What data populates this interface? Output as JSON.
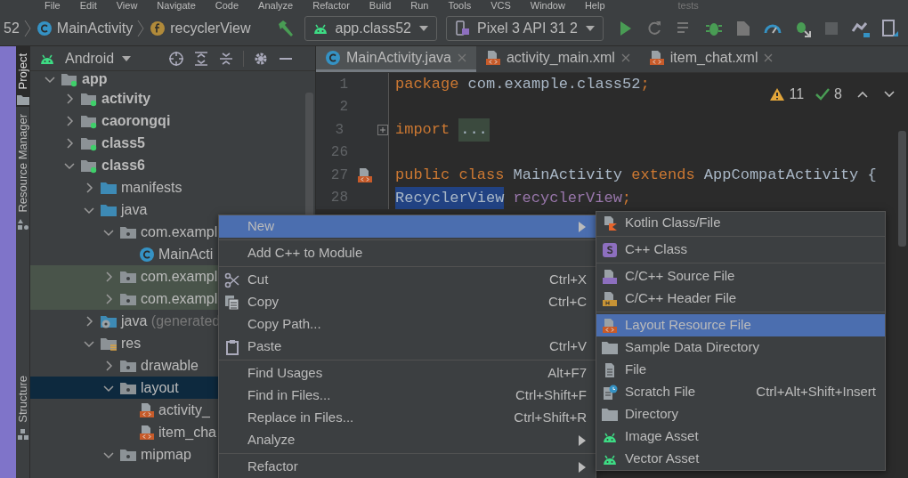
{
  "menu_bar": {
    "items": [
      "File",
      "Edit",
      "View",
      "Navigate",
      "Code",
      "Analyze",
      "Refactor",
      "Build",
      "Run",
      "Tools",
      "VCS",
      "Window",
      "Help"
    ],
    "title": "tests"
  },
  "toolbar": {
    "breadcrumbs": [
      {
        "kind": "plain",
        "label": "52"
      },
      {
        "kind": "class",
        "label": "MainActivity"
      },
      {
        "kind": "field",
        "label": "recyclerView"
      }
    ],
    "run_config": "app.class52",
    "device": "Pixel 3 API 31 2"
  },
  "tool_stripe": [
    {
      "label": "Project",
      "selected": true,
      "kind": "folder"
    },
    {
      "label": "Resource Manager",
      "selected": false,
      "kind": "shapes"
    },
    {
      "label": "Structure",
      "selected": false,
      "kind": "structure"
    }
  ],
  "project_panel": {
    "view": "Android",
    "tree": [
      {
        "label": "app",
        "kind": "module",
        "selected": false,
        "expanded": true,
        "children": [
          {
            "label": "activity",
            "kind": "module",
            "selected": false,
            "expanded": false
          },
          {
            "label": "caorongqi",
            "kind": "module",
            "selected": false,
            "expanded": false
          },
          {
            "label": "class5",
            "kind": "module",
            "selected": false,
            "expanded": false
          },
          {
            "label": "class6",
            "kind": "module",
            "selected": false,
            "expanded": true,
            "children": [
              {
                "label": "manifests",
                "kind": "folder",
                "selected": false,
                "expanded": false
              },
              {
                "label": "java",
                "kind": "folder",
                "selected": false,
                "expanded": true,
                "children": [
                  {
                    "label": "com.exampl",
                    "kind": "package",
                    "selected": false,
                    "expanded": true,
                    "children": [
                      {
                        "label": "MainActi",
                        "kind": "class",
                        "selected": false
                      }
                    ]
                  },
                  {
                    "label": "com.exampl",
                    "kind": "testpackage",
                    "selected": false,
                    "expanded": false
                  },
                  {
                    "label": "com.exampl",
                    "kind": "testpackage",
                    "selected": false,
                    "expanded": false
                  }
                ]
              },
              {
                "label": "java (generated",
                "kind": "generated",
                "selected": false,
                "expanded": false
              },
              {
                "label": "res",
                "kind": "res",
                "selected": false,
                "expanded": true,
                "children": [
                  {
                    "label": "drawable",
                    "kind": "package",
                    "selected": false,
                    "expanded": false
                  },
                  {
                    "label": "layout",
                    "kind": "package",
                    "selected": true,
                    "expanded": true,
                    "children": [
                      {
                        "label": "activity_",
                        "kind": "layout",
                        "selected": false
                      },
                      {
                        "label": "item_cha",
                        "kind": "layout",
                        "selected": false
                      }
                    ]
                  },
                  {
                    "label": "mipmap",
                    "kind": "package",
                    "selected": false,
                    "expanded": true
                  }
                ]
              }
            ]
          }
        ]
      }
    ]
  },
  "editor": {
    "tabs": [
      {
        "label": "MainActivity.java",
        "kind": "java",
        "selected": true
      },
      {
        "label": "activity_main.xml",
        "kind": "xml",
        "selected": false
      },
      {
        "label": "item_chat.xml",
        "kind": "xml",
        "selected": false
      }
    ],
    "warnings": "11",
    "passed": "8",
    "lines": [
      {
        "number": "1",
        "kind": "plain",
        "tokens": [
          {
            "kind": "keyword",
            "text": "package"
          },
          {
            "kind": "plain",
            "text": " com.example.class52"
          },
          {
            "kind": "keyword",
            "text": ";"
          }
        ]
      },
      {
        "number": "2",
        "kind": "plain"
      },
      {
        "number": "3",
        "kind": "fold",
        "tokens": [
          {
            "kind": "keyword",
            "text": "import"
          },
          {
            "kind": "folded",
            "text": "..."
          }
        ]
      },
      {
        "number": "26",
        "kind": "plain"
      },
      {
        "number": "27",
        "kind": "layout",
        "tokens": [
          {
            "kind": "keyword",
            "text": "public class"
          },
          {
            "kind": "plain",
            "text": " MainActivity "
          },
          {
            "kind": "keyword",
            "text": "extends"
          },
          {
            "kind": "plain",
            "text": " AppCompatActivity {"
          }
        ]
      },
      {
        "number": "28",
        "kind": "plain",
        "tokens": [
          {
            "kind": "selected",
            "text": "RecyclerView"
          },
          {
            "kind": "field",
            "text": "recyclerView"
          },
          {
            "kind": "keyword",
            "text": ";"
          }
        ]
      }
    ]
  },
  "context_menu": {
    "items": [
      {
        "kind": "item",
        "label": "New",
        "selected": true,
        "submenu": true
      },
      {
        "kind": "separator"
      },
      {
        "kind": "item",
        "label": "Add C++ to Module",
        "selected": false,
        "submenu": false
      },
      {
        "kind": "separator"
      },
      {
        "kind": "cut",
        "label": "Cut",
        "shortcut": "Ctrl+X",
        "selected": false,
        "submenu": false
      },
      {
        "kind": "copy",
        "label": "Copy",
        "shortcut": "Ctrl+C",
        "selected": false,
        "submenu": false
      },
      {
        "kind": "item",
        "label": "Copy Path...",
        "selected": false,
        "submenu": false
      },
      {
        "kind": "paste",
        "label": "Paste",
        "shortcut": "Ctrl+V",
        "selected": false,
        "submenu": false
      },
      {
        "kind": "separator"
      },
      {
        "kind": "item",
        "label": "Find Usages",
        "shortcut": "Alt+F7",
        "selected": false,
        "submenu": false
      },
      {
        "kind": "item",
        "label": "Find in Files...",
        "shortcut": "Ctrl+Shift+F",
        "selected": false,
        "submenu": false
      },
      {
        "kind": "item",
        "label": "Replace in Files...",
        "shortcut": "Ctrl+Shift+R",
        "selected": false,
        "submenu": false
      },
      {
        "kind": "item",
        "label": "Analyze",
        "selected": false,
        "submenu": true
      },
      {
        "kind": "separator"
      },
      {
        "kind": "item",
        "label": "Refactor",
        "selected": false,
        "submenu": true
      }
    ]
  },
  "submenu": {
    "items": [
      {
        "kind": "kotlin",
        "label": "Kotlin Class/File",
        "selected": false
      },
      {
        "kind": "separator"
      },
      {
        "kind": "cppclass",
        "label": "C++ Class",
        "selected": false
      },
      {
        "kind": "separator"
      },
      {
        "kind": "source",
        "label": "C/C++ Source File",
        "selected": false
      },
      {
        "kind": "header",
        "label": "C/C++ Header File",
        "selected": false
      },
      {
        "kind": "separator"
      },
      {
        "kind": "layout",
        "label": "Layout Resource File",
        "selected": true
      },
      {
        "kind": "folder",
        "label": "Sample Data Directory",
        "selected": false
      },
      {
        "kind": "file",
        "label": "File",
        "selected": false
      },
      {
        "kind": "scratch",
        "label": "Scratch File",
        "shortcut": "Ctrl+Alt+Shift+Insert",
        "selected": false
      },
      {
        "kind": "folder",
        "label": "Directory",
        "selected": false
      },
      {
        "kind": "android",
        "label": "Image Asset",
        "selected": false
      },
      {
        "kind": "android",
        "label": "Vector Asset",
        "selected": false
      }
    ]
  }
}
